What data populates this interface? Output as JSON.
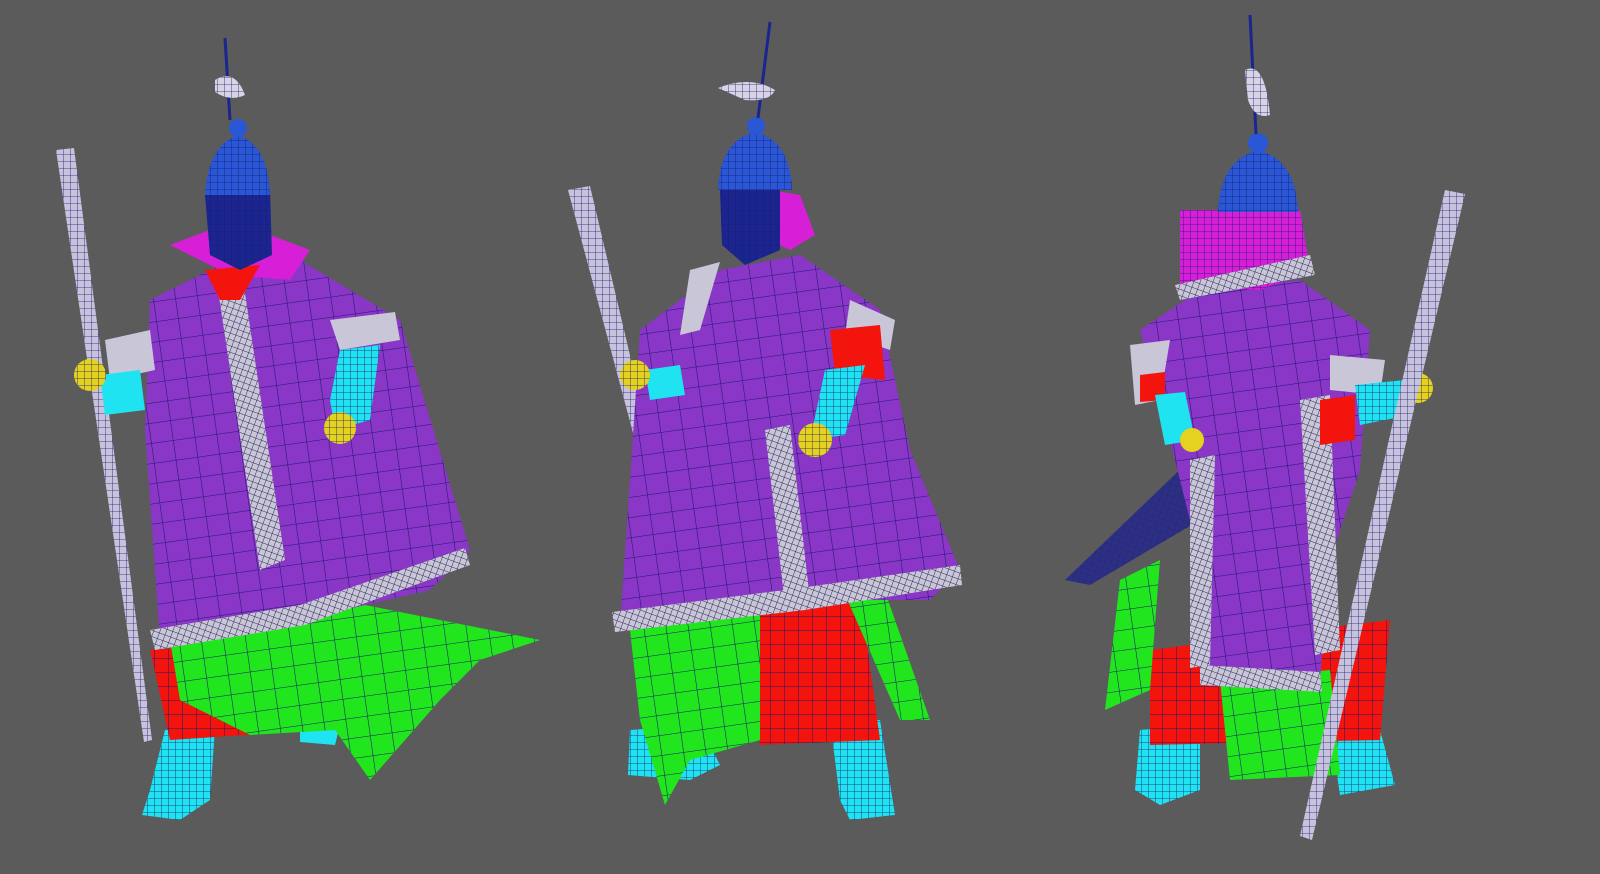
{
  "viewport": {
    "background": "#5b5b5b",
    "wire_color": "#1c1a6e",
    "trim_color": "#c9c6d8"
  },
  "materials": {
    "helmet": "#2a57d6",
    "helmet_flap": "#d81fd8",
    "face_mask": "#1b2590",
    "robe": "#8a36c6",
    "robe_trim": "#c9c6d8",
    "under_skirt": "#21e61d",
    "red_cloth": "#f3150d",
    "skin_arms_boots": "#1fe3f0",
    "gloves": "#e4d21f",
    "spear": "#c7c3dd",
    "plume": "#d8d4e6"
  },
  "figures": [
    {
      "view": "front-left"
    },
    {
      "view": "front-right"
    },
    {
      "view": "back"
    }
  ]
}
